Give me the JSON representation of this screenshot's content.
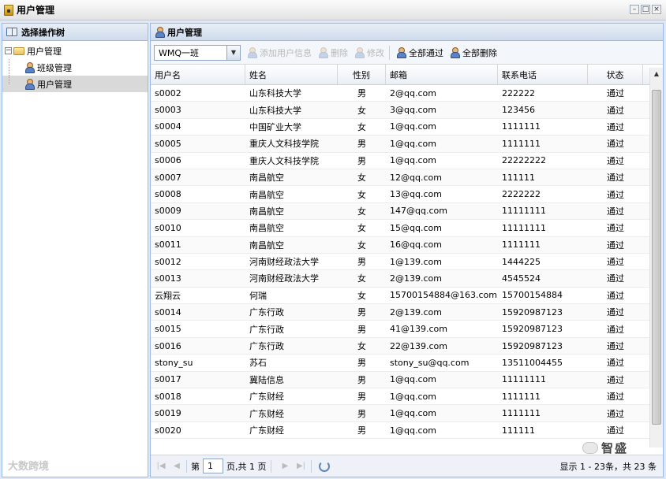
{
  "window": {
    "title": "用户管理",
    "controls": [
      "–",
      "□",
      "×"
    ]
  },
  "left_panel": {
    "title": "选择操作树",
    "tree": [
      {
        "label": "用户管理",
        "expander": "−"
      },
      {
        "label": "班级管理"
      },
      {
        "label": "用户管理"
      }
    ]
  },
  "main_panel": {
    "title": "用户管理",
    "toolbar": {
      "class_select": "WMQ一班",
      "buttons": [
        {
          "label": "添加用户信息",
          "enabled": false
        },
        {
          "label": "删除",
          "enabled": false
        },
        {
          "label": "修改",
          "enabled": false
        },
        {
          "label": "全部通过",
          "enabled": true
        },
        {
          "label": "全部删除",
          "enabled": true
        }
      ]
    },
    "table": {
      "headers": [
        "用户名",
        "姓名",
        "性别",
        "邮箱",
        "联系电话",
        "状态"
      ],
      "rows": [
        [
          "s0002",
          "山东科技大学",
          "男",
          "2@qq.com",
          "222222",
          "通过"
        ],
        [
          "s0003",
          "山东科技大学",
          "女",
          "3@qq.com",
          "123456",
          "通过"
        ],
        [
          "s0004",
          "中国矿业大学",
          "女",
          "1@qq.com",
          "1111111",
          "通过"
        ],
        [
          "s0005",
          "重庆人文科技学院",
          "男",
          "1@qq.com",
          "1111111",
          "通过"
        ],
        [
          "s0006",
          "重庆人文科技学院",
          "男",
          "1@qq.com",
          "22222222",
          "通过"
        ],
        [
          "s0007",
          "南昌航空",
          "女",
          "12@qq.com",
          "111111",
          "通过"
        ],
        [
          "s0008",
          "南昌航空",
          "女",
          "13@qq.com",
          "2222222",
          "通过"
        ],
        [
          "s0009",
          "南昌航空",
          "女",
          "147@qq.com",
          "11111111",
          "通过"
        ],
        [
          "s0010",
          "南昌航空",
          "女",
          "15@qq.com",
          "11111111",
          "通过"
        ],
        [
          "s0011",
          "南昌航空",
          "女",
          "16@qq.com",
          "1111111",
          "通过"
        ],
        [
          "s0012",
          "河南财经政法大学",
          "男",
          "1@139.com",
          "1444225",
          "通过"
        ],
        [
          "s0013",
          "河南财经政法大学",
          "女",
          "2@139.com",
          "4545524",
          "通过"
        ],
        [
          "云翔云",
          "何瑞",
          "女",
          "15700154884@163.com",
          "15700154884",
          "通过"
        ],
        [
          "s0014",
          "广东行政",
          "男",
          "2@139.com",
          "15920987123",
          "通过"
        ],
        [
          "s0015",
          "广东行政",
          "男",
          "41@139.com",
          "15920987123",
          "通过"
        ],
        [
          "s0016",
          "广东行政",
          "女",
          "22@139.com",
          "15920987123",
          "通过"
        ],
        [
          "stony_su",
          "苏石",
          "男",
          "stony_su@qq.com",
          "13511004455",
          "通过"
        ],
        [
          "s0017",
          "冀陆信息",
          "男",
          "1@qq.com",
          "11111111",
          "通过"
        ],
        [
          "s0018",
          "广东财经",
          "男",
          "1@qq.com",
          "1111111",
          "通过"
        ],
        [
          "s0019",
          "广东财经",
          "男",
          "1@qq.com",
          "1111111",
          "通过"
        ],
        [
          "s0020",
          "广东财经",
          "男",
          "1@qq.com",
          "111111",
          "通过"
        ]
      ]
    },
    "pager": {
      "prefix": "第",
      "page": "1",
      "suffix": "页,共 1 页",
      "info": "显示 1 - 23条，共 23 条"
    }
  },
  "watermarks": {
    "left": "大数跨境",
    "right": "智盛"
  }
}
